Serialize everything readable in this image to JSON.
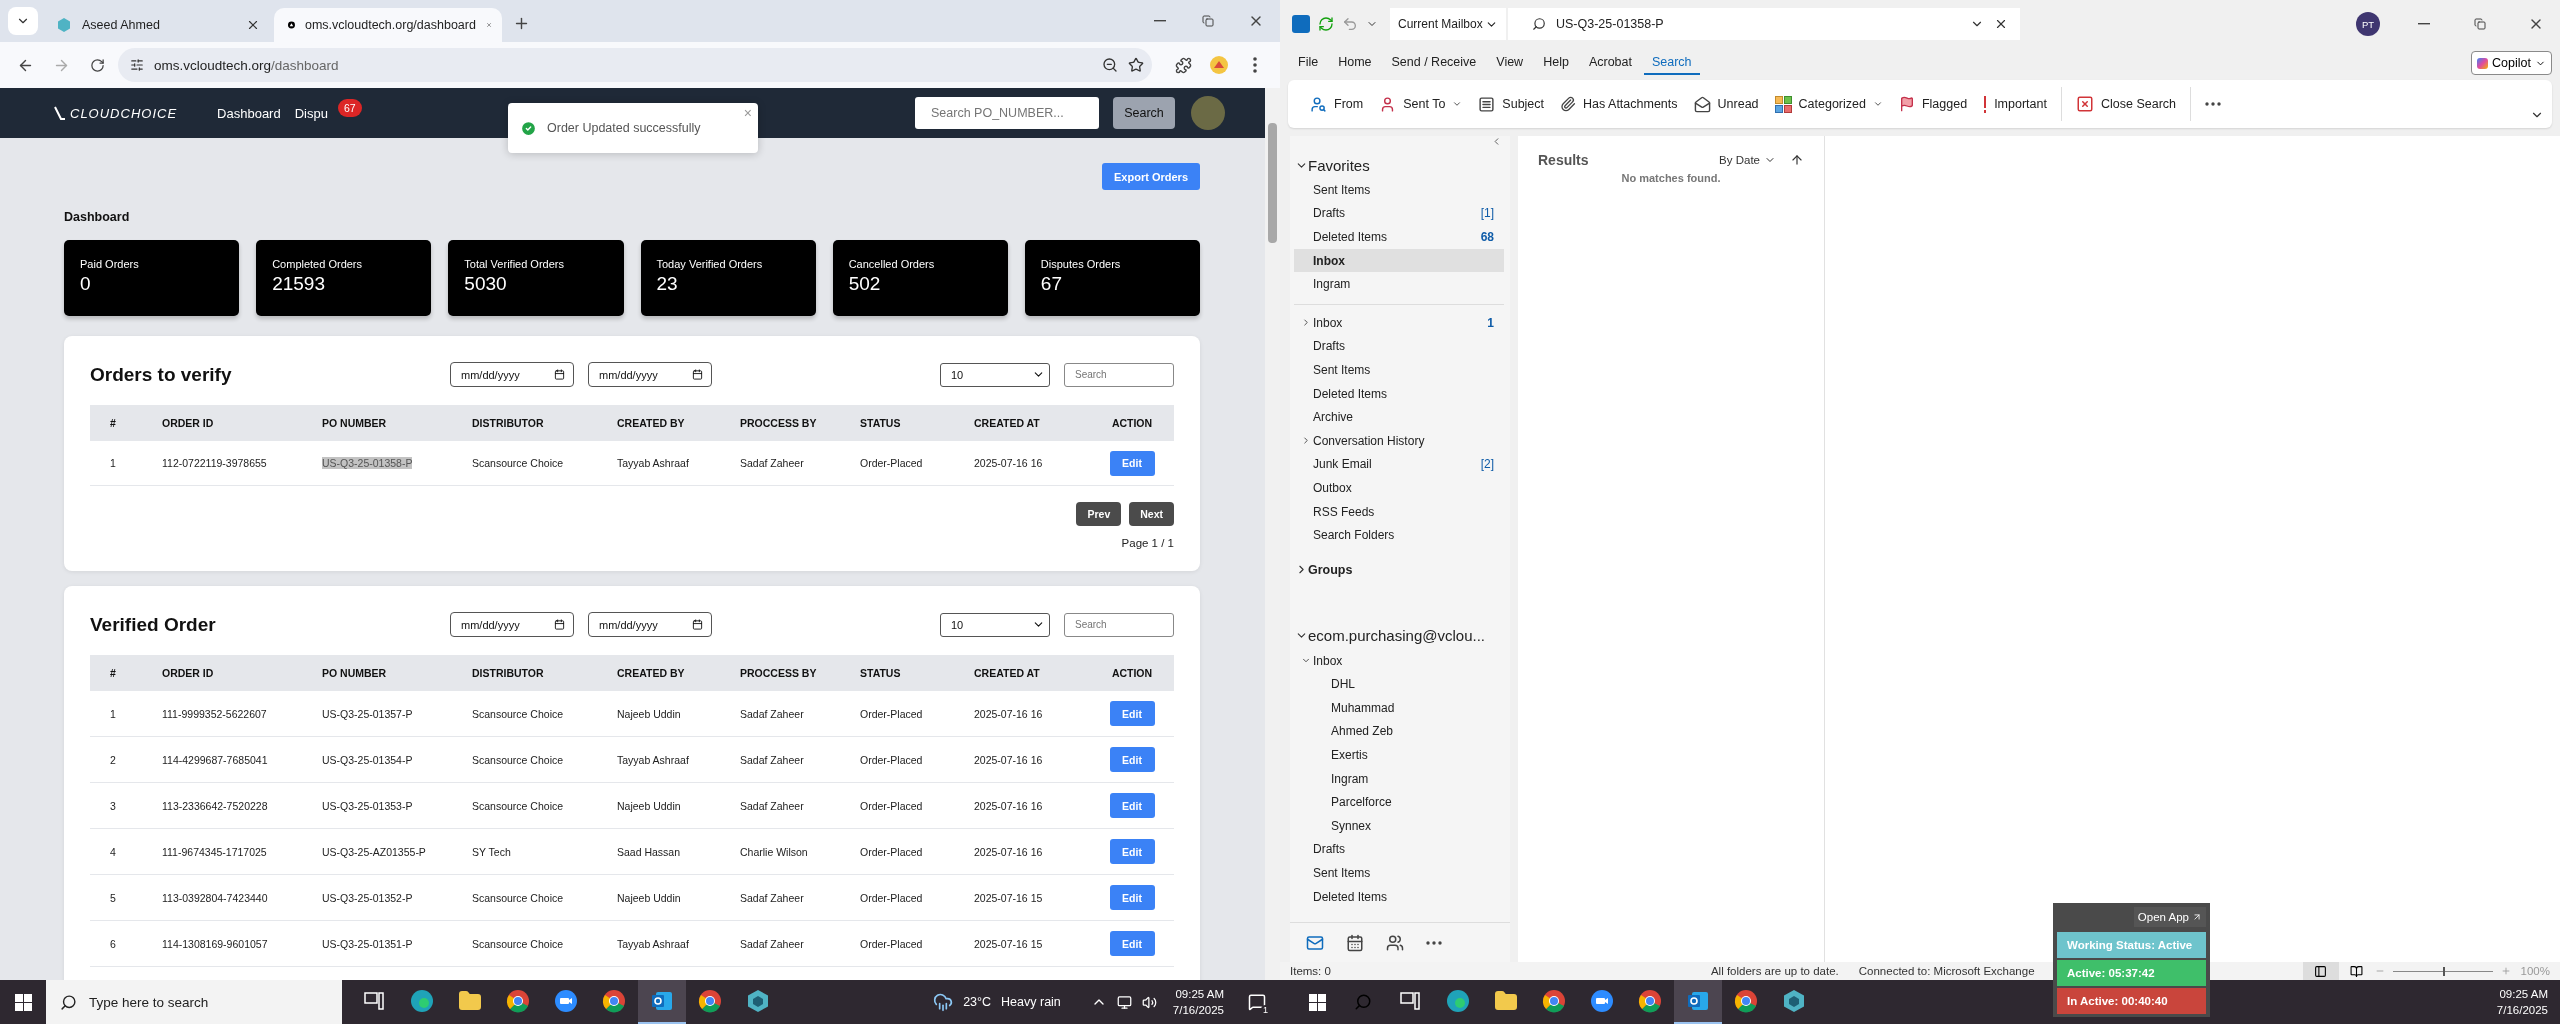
{
  "browser": {
    "tabs": [
      {
        "title": "Aseed Ahmed",
        "selected": false
      },
      {
        "title": "oms.vcloudtech.org/dashboard",
        "selected": true
      }
    ],
    "url_host": "oms.vcloudtech.org",
    "url_path": "/dashboard"
  },
  "app": {
    "logo": "CLOUDCHOICE",
    "nav": [
      {
        "label": "Dashboard"
      },
      {
        "label": "Dispu",
        "badge": "67"
      }
    ],
    "search_placeholder": "Search PO_NUMBER...",
    "search_button": "Search"
  },
  "toast": {
    "message": "Order Updated successfully",
    "close": "×"
  },
  "export_button": "Export Orders",
  "dashboard_title": "Dashboard",
  "stats": [
    {
      "label": "Paid Orders",
      "value": "0"
    },
    {
      "label": "Completed Orders",
      "value": "21593"
    },
    {
      "label": "Total Verified Orders",
      "value": "5030"
    },
    {
      "label": "Today Verified Orders",
      "value": "23"
    },
    {
      "label": "Cancelled Orders",
      "value": "502"
    },
    {
      "label": "Disputes Orders",
      "value": "67"
    }
  ],
  "orders_to_verify": {
    "title": "Orders to verify",
    "date_placeholders": [
      "mm/dd/yyyy",
      "mm/dd/yyyy"
    ],
    "page_size": "10",
    "search_placeholder": "Search",
    "columns": [
      "#",
      "ORDER ID",
      "PO NUMBER",
      "DISTRIBUTOR",
      "CREATED BY",
      "PROCCESS BY",
      "STATUS",
      "CREATED AT",
      "ACTION"
    ],
    "rows": [
      {
        "cells": [
          "1",
          "112-0722119-3978655",
          "US-Q3-25-01358-P",
          "Scansource Choice",
          "Tayyab Ashraaf",
          "Sadaf Zaheer",
          "Order-Placed",
          "2025-07-16 16"
        ],
        "action": "Edit",
        "po_selected": true
      }
    ],
    "prev": "Prev",
    "next": "Next",
    "page": "Page 1 / 1"
  },
  "verified_orders": {
    "title": "Verified Order",
    "date_placeholders": [
      "mm/dd/yyyy",
      "mm/dd/yyyy"
    ],
    "page_size": "10",
    "search_placeholder": "Search",
    "columns": [
      "#",
      "ORDER ID",
      "PO NUMBER",
      "DISTRIBUTOR",
      "CREATED BY",
      "PROCCESS BY",
      "STATUS",
      "CREATED AT",
      "ACTION"
    ],
    "rows": [
      {
        "cells": [
          "1",
          "111-9999352-5622607",
          "US-Q3-25-01357-P",
          "Scansource Choice",
          "Najeeb Uddin",
          "Sadaf Zaheer",
          "Order-Placed",
          "2025-07-16 16"
        ],
        "action": "Edit",
        "po_selected": false
      },
      {
        "cells": [
          "2",
          "114-4299687-7685041",
          "US-Q3-25-01354-P",
          "Scansource Choice",
          "Tayyab Ashraaf",
          "Sadaf Zaheer",
          "Order-Placed",
          "2025-07-16 16"
        ],
        "action": "Edit",
        "po_selected": false
      },
      {
        "cells": [
          "3",
          "113-2336642-7520228",
          "US-Q3-25-01353-P",
          "Scansource Choice",
          "Najeeb Uddin",
          "Sadaf Zaheer",
          "Order-Placed",
          "2025-07-16 16"
        ],
        "action": "Edit",
        "po_selected": false
      },
      {
        "cells": [
          "4",
          "111-9674345-1717025",
          "US-Q3-25-AZ01355-P",
          "SY Tech",
          "Saad Hassan",
          "Charlie Wilson",
          "Order-Placed",
          "2025-07-16 16"
        ],
        "action": "Edit",
        "po_selected": false
      },
      {
        "cells": [
          "5",
          "113-0392804-7423440",
          "US-Q3-25-01352-P",
          "Scansource Choice",
          "Najeeb Uddin",
          "Sadaf Zaheer",
          "Order-Placed",
          "2025-07-16 15"
        ],
        "action": "Edit",
        "po_selected": false
      },
      {
        "cells": [
          "6",
          "114-1308169-9601057",
          "US-Q3-25-01351-P",
          "Scansource Choice",
          "Tayyab Ashraaf",
          "Sadaf Zaheer",
          "Order-Placed",
          "2025-07-16 15"
        ],
        "action": "Edit",
        "po_selected": false
      }
    ]
  },
  "outlook": {
    "scope": "Current Mailbox",
    "search_value": "US-Q3-25-01358-P",
    "avatar": "PT",
    "menu": [
      {
        "label": "File",
        "selected": false
      },
      {
        "label": "Home",
        "selected": false
      },
      {
        "label": "Send / Receive",
        "selected": false
      },
      {
        "label": "View",
        "selected": false
      },
      {
        "label": "Help",
        "selected": false
      },
      {
        "label": "Acrobat",
        "selected": false
      },
      {
        "label": "Search",
        "selected": true
      }
    ],
    "copilot": "Copilot",
    "ribbon": [
      {
        "label": "From",
        "dropdown": false
      },
      {
        "label": "Sent To",
        "dropdown": true
      },
      {
        "label": "Subject",
        "dropdown": false
      },
      {
        "label": "Has Attachments",
        "dropdown": false
      },
      {
        "label": "Unread",
        "dropdown": false
      },
      {
        "label": "Categorized",
        "dropdown": true
      },
      {
        "label": "Flagged",
        "dropdown": false
      },
      {
        "label": "Important",
        "dropdown": false
      },
      {
        "label": "Close Search",
        "dropdown": false
      }
    ],
    "sections": [
      {
        "title": "Favorites",
        "expanded": true,
        "items": [
          {
            "label": "Sent Items",
            "selected": false
          },
          {
            "label": "Drafts",
            "count": "[1]",
            "unread": false,
            "selected": false
          },
          {
            "label": "Deleted Items",
            "count": "68",
            "unread": true,
            "selected": false
          },
          {
            "label": "Inbox",
            "selected": true
          },
          {
            "label": "Ingram",
            "selected": false
          }
        ]
      },
      {
        "items": [
          {
            "label": "Inbox",
            "count": "1",
            "unread": true,
            "expanded": false,
            "selected": false
          },
          {
            "label": "Drafts",
            "selected": false
          },
          {
            "label": "Sent Items",
            "selected": false
          },
          {
            "label": "Deleted Items",
            "selected": false
          },
          {
            "label": "Archive",
            "selected": false
          },
          {
            "label": "Conversation History",
            "expanded": false,
            "selected": false
          },
          {
            "label": "Junk Email",
            "count": "[2]",
            "unread": false,
            "selected": false
          },
          {
            "label": "Outbox",
            "selected": false
          },
          {
            "label": "RSS Feeds",
            "selected": false
          },
          {
            "label": "Search Folders",
            "selected": false
          }
        ]
      },
      {
        "title": "Groups",
        "expanded": false
      },
      {
        "title": "ecom.purchasing@vclou...",
        "expanded": true,
        "items": [
          {
            "label": "Inbox",
            "expanded": true,
            "selected": false,
            "children": [
              {
                "label": "DHL",
                "selected": false
              },
              {
                "label": "Muhammad",
                "selected": false
              },
              {
                "label": "Ahmed Zeb",
                "selected": false
              },
              {
                "label": "Exertis",
                "selected": false
              },
              {
                "label": "Ingram",
                "selected": false
              },
              {
                "label": "Parcelforce",
                "selected": false
              },
              {
                "label": "Synnex",
                "selected": false
              }
            ]
          },
          {
            "label": "Drafts",
            "selected": false
          },
          {
            "label": "Sent Items",
            "selected": false
          },
          {
            "label": "Deleted Items",
            "selected": false
          }
        ]
      }
    ],
    "results_title": "Results",
    "sort": "By Date",
    "empty": "No matches found.",
    "status": {
      "items": "Items: 0",
      "sync": "All folders are up to date.",
      "connection": "Connected to: Microsoft Exchange",
      "zoom": "100%",
      "zoom_slider": {
        "level": 0.5
      }
    }
  },
  "tracker": {
    "open": "Open App",
    "rows": [
      {
        "text": "Working Status: Active",
        "color": "#6ec4cc"
      },
      {
        "text": "Active: 05:37:42",
        "color": "#3fbf6a"
      },
      {
        "text": "In Active: 00:40:40",
        "color": "#c9453c"
      }
    ]
  },
  "taskbar_left": {
    "search_placeholder": "Type here to search",
    "apps": [
      {
        "selected": false
      },
      {
        "selected": false
      },
      {
        "selected": false
      },
      {
        "selected": false
      },
      {
        "selected": false
      },
      {
        "selected": false
      },
      {
        "selected": true
      },
      {
        "selected": false
      },
      {
        "selected": false
      }
    ],
    "temperature": "23°C",
    "weather": "Heavy rain",
    "time": "09:25 AM",
    "date": "7/16/2025",
    "notifications": "1"
  },
  "taskbar_right": {
    "apps": [
      {
        "selected": false
      },
      {
        "selected": false
      },
      {
        "selected": false
      },
      {
        "selected": false
      },
      {
        "selected": false
      },
      {
        "selected": false
      },
      {
        "selected": true
      },
      {
        "selected": false
      },
      {
        "selected": false
      }
    ],
    "time": "09:25 AM",
    "date": "7/16/2025"
  }
}
